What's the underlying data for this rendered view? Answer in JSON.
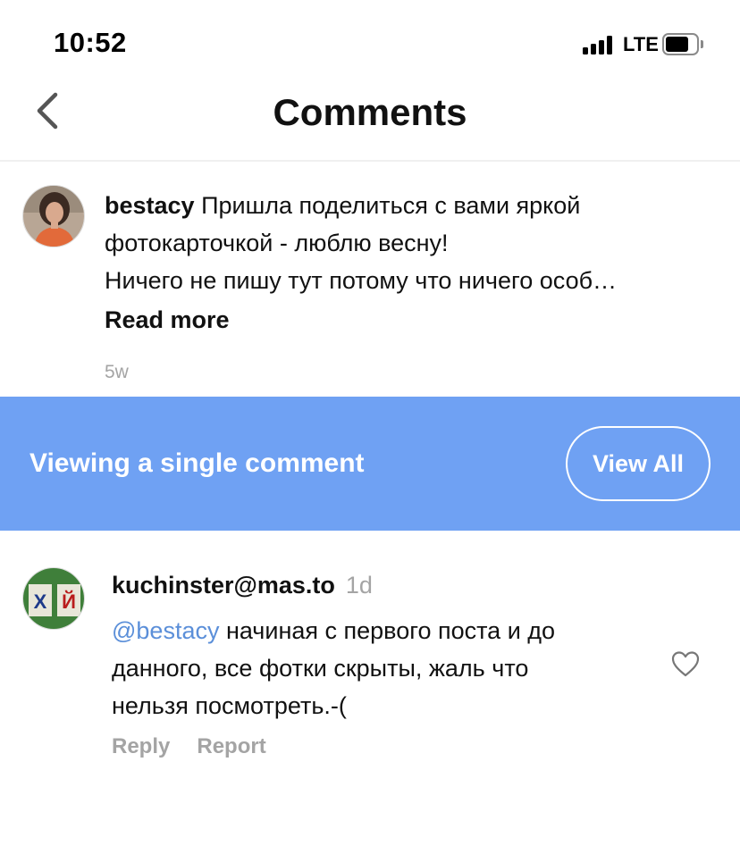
{
  "status_bar": {
    "time": "10:52",
    "network": "LTE"
  },
  "nav": {
    "title": "Comments",
    "back_icon": "chevron-left-icon"
  },
  "post": {
    "username": "bestacy",
    "text_line1": " Пришла поделиться с вами яркой",
    "text_line2": "фотокарточкой - люблю весну!",
    "text_line3": "Ничего не пишу тут потому что ничего особ…",
    "read_more": "Read more",
    "time": "5w"
  },
  "banner": {
    "text": "Viewing a single comment",
    "button": "View All",
    "color": "#6fa1f3"
  },
  "comment": {
    "username": "kuchinster@mas.to",
    "time": "1d",
    "mention": "@bestacy",
    "text_part1": " начиная с первого поста и до",
    "text_line2": "данного, все фотки скрыты, жаль что",
    "text_line3": "нельзя посмотреть.-(",
    "reply": "Reply",
    "report": "Report",
    "like_icon": "heart-icon",
    "mention_color": "#5b8fd9"
  }
}
